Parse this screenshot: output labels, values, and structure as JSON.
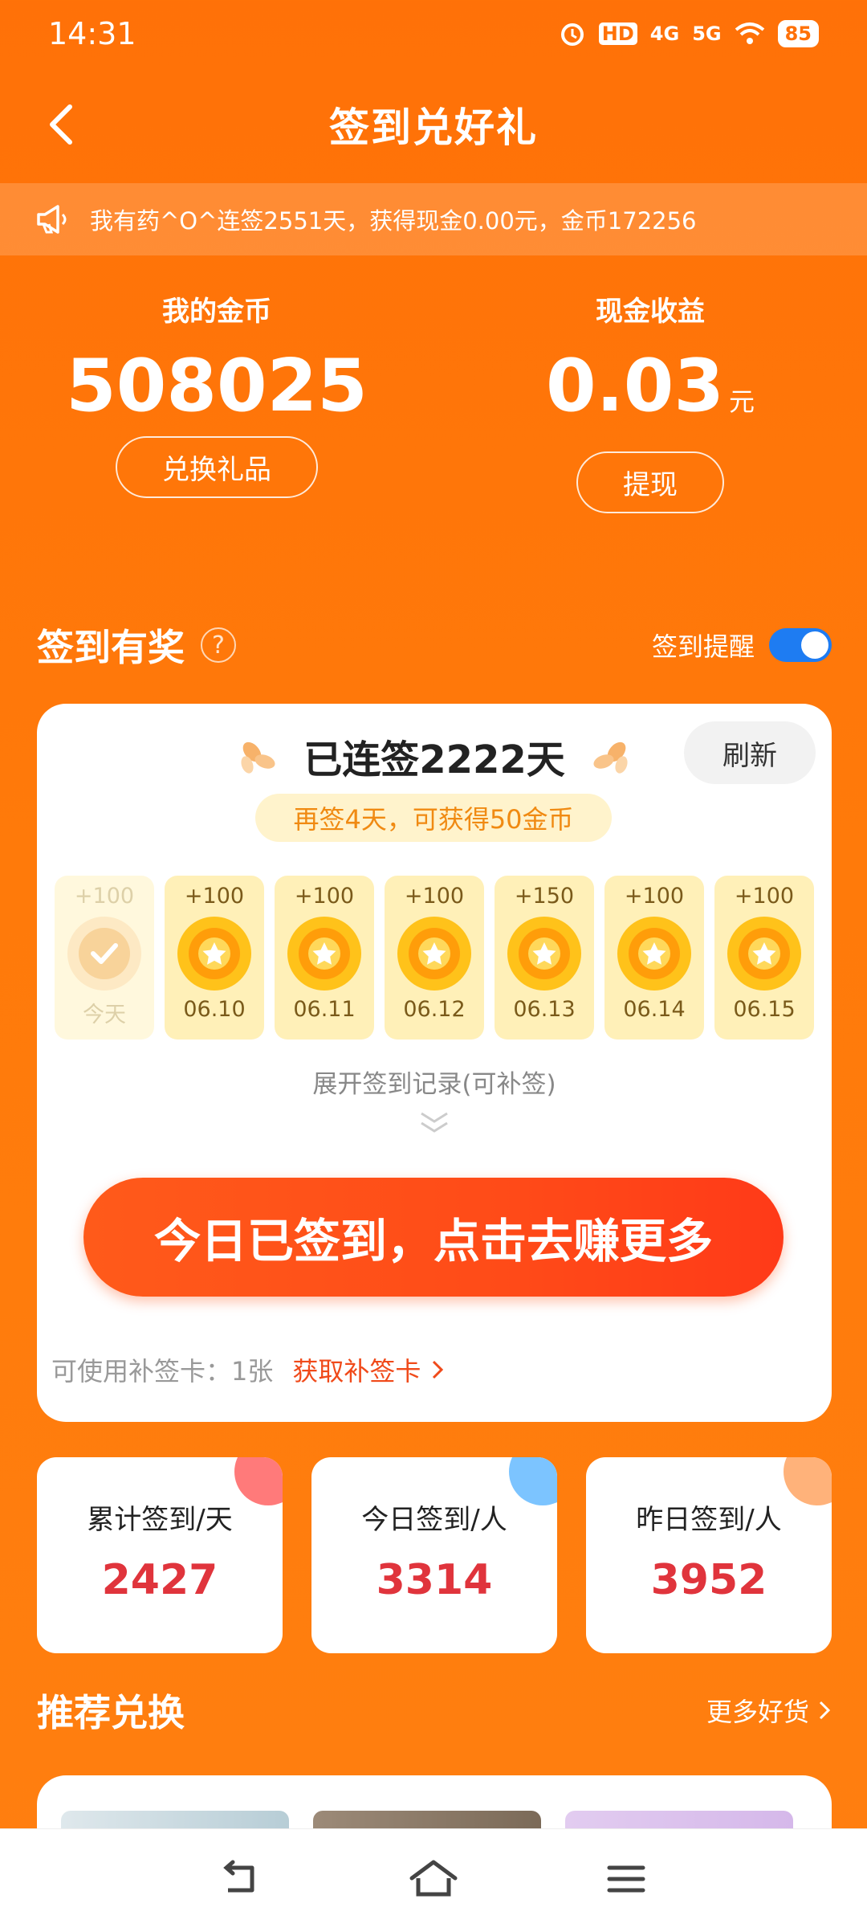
{
  "status_bar": {
    "time": "14:31",
    "battery": "85",
    "network_1": "4G",
    "network_2": "5G",
    "hd": "HD"
  },
  "nav": {
    "title": "签到兑好礼"
  },
  "notice": {
    "text": "我有药^O^连签2551天，获得现金0.00元，金币172256"
  },
  "coins": {
    "label": "我的金币",
    "value": "508025",
    "button": "兑换礼品"
  },
  "cash": {
    "label": "现金收益",
    "value": "0.03",
    "unit": "元",
    "button": "提现"
  },
  "signin_section": {
    "title": "签到有奖",
    "help_mark": "?",
    "reminder_label": "签到提醒",
    "reminder_on": true
  },
  "signin_card": {
    "streak_text": "已连签2222天",
    "refresh_label": "刷新",
    "hint": "再签4天，可获得50金币",
    "days": [
      {
        "points": "+100",
        "date": "今天",
        "done": true
      },
      {
        "points": "+100",
        "date": "06.10",
        "done": false
      },
      {
        "points": "+100",
        "date": "06.11",
        "done": false
      },
      {
        "points": "+100",
        "date": "06.12",
        "done": false
      },
      {
        "points": "+150",
        "date": "06.13",
        "done": false
      },
      {
        "points": "+100",
        "date": "06.14",
        "done": false
      },
      {
        "points": "+100",
        "date": "06.15",
        "done": false
      }
    ],
    "expand_label": "展开签到记录(可补签)",
    "main_button": "今日已签到，点击去赚更多",
    "makeup_label": "可使用补签卡：",
    "makeup_count": "1张",
    "makeup_link": "获取补签卡"
  },
  "summary": [
    {
      "label": "累计签到/天",
      "value": "2427",
      "accent": "#ff7a7a"
    },
    {
      "label": "今日签到/人",
      "value": "3314",
      "accent": "#7cc4ff"
    },
    {
      "label": "昨日签到/人",
      "value": "3952",
      "accent": "#ffb27a"
    }
  ],
  "recommend": {
    "title": "推荐兑换",
    "more": "更多好货"
  },
  "colors": {
    "brand_orange": "#ff7108",
    "toggle_blue": "#1e7cf2",
    "value_red": "#e0343c",
    "cta_red": "#ff4b18"
  }
}
